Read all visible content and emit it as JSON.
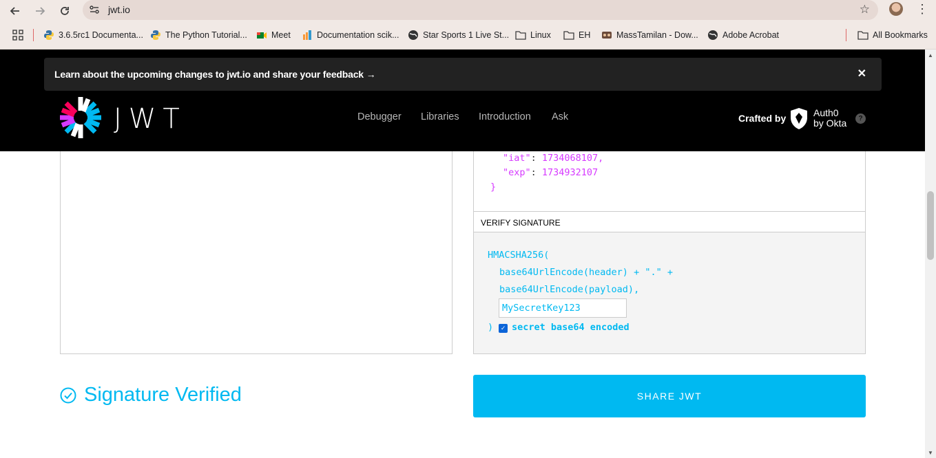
{
  "browser": {
    "url": "jwt.io",
    "bookmarks": [
      "3.6.5rc1 Documenta...",
      "The Python Tutorial...",
      "Meet",
      "Documentation scik...",
      "Star Sports 1 Live St...",
      "Linux",
      "EH",
      "MassTamilan - Dow...",
      "Adobe Acrobat"
    ],
    "all_bookmarks": "All Bookmarks",
    "nav_icons": [
      "back-arrow-icon",
      "forward-arrow-icon",
      "reload-icon"
    ]
  },
  "banner": {
    "text": "Learn about the upcoming changes to jwt.io and share your feedback →",
    "close": "✕"
  },
  "header": {
    "logo_text": "JWT",
    "nav": [
      "Debugger",
      "Libraries",
      "Introduction",
      "Ask"
    ],
    "crafted_by": "Crafted by",
    "auth0_line1": "Auth0",
    "auth0_line2": "by Okta",
    "help": "?"
  },
  "payload": {
    "iat_key": "\"iat\"",
    "iat_val": "1734068107,",
    "exp_key": "\"exp\"",
    "exp_val": "1734932107",
    "close_brace": "}"
  },
  "verify": {
    "title": "VERIFY SIGNATURE",
    "line1": "HMACSHA256(",
    "line2": "base64UrlEncode(header) + \".\" +",
    "line3": "base64UrlEncode(payload),",
    "secret": "MySecretKey123",
    "close_paren": ")",
    "checkbox_label": "secret base64 encoded",
    "checkbox_checked": true
  },
  "status": {
    "text": "Signature Verified"
  },
  "share_button": "SHARE JWT",
  "colors": {
    "accent": "#00b9f1",
    "payload": "#d63aff"
  }
}
